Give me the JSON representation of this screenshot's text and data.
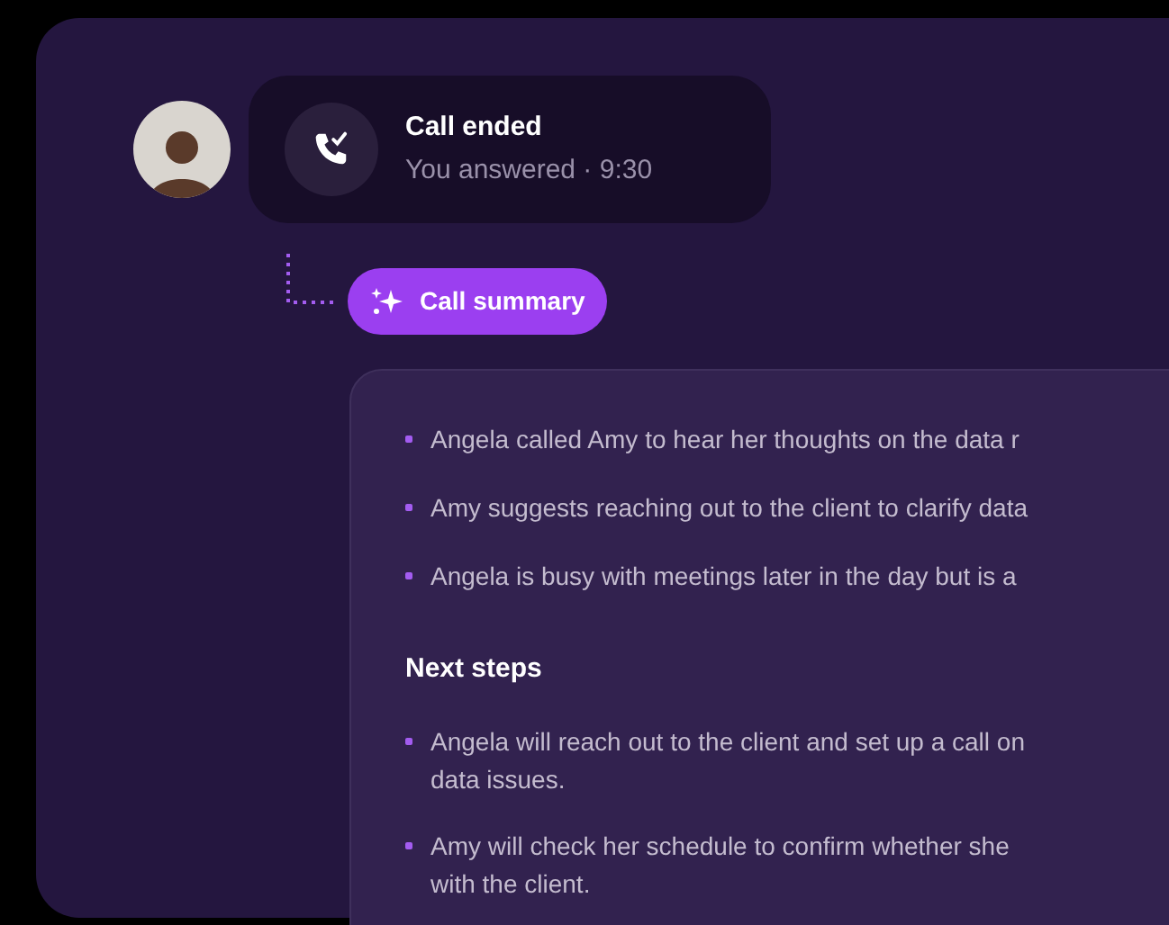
{
  "call": {
    "title": "Call ended",
    "subtitle": "You answered · 9:30"
  },
  "summary_button": {
    "label": "Call summary"
  },
  "summary": {
    "points": [
      {
        "lines": [
          "Angela called Amy to hear her thoughts on the data r"
        ]
      },
      {
        "lines": [
          "Amy suggests reaching out to the client to clarify data"
        ]
      },
      {
        "lines": [
          "Angela is busy with meetings later in the day but is a"
        ]
      }
    ],
    "next_steps_heading": "Next steps",
    "next_steps": [
      {
        "lines": [
          "Angela will reach out to the client and set up a call on",
          "data issues."
        ]
      },
      {
        "lines": [
          "Amy will check her schedule to confirm whether she",
          "with the client."
        ]
      }
    ]
  }
}
